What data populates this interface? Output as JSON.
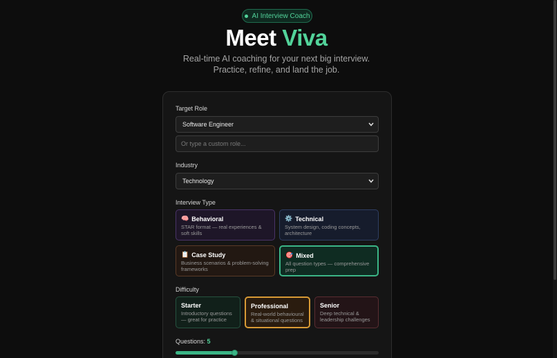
{
  "badge": {
    "label": "AI Interview Coach"
  },
  "hero": {
    "title_prefix": "Meet",
    "title_accent": "Viva",
    "subtitle_line1": "Real-time AI coaching for your next big interview.",
    "subtitle_line2": "Practice, refine, and land the job."
  },
  "form": {
    "target_role": {
      "label": "Target Role",
      "selected": "Software Engineer",
      "custom_placeholder": "Or type a custom role..."
    },
    "industry": {
      "label": "Industry",
      "selected": "Technology"
    },
    "interview_type": {
      "label": "Interview Type",
      "options": [
        {
          "icon": "🧠",
          "icon_name": "brain-icon",
          "title": "Behavioral",
          "desc": "STAR format — real experiences & soft skills"
        },
        {
          "icon": "⚙️",
          "icon_name": "gear-icon",
          "title": "Technical",
          "desc": "System design, coding concepts, architecture"
        },
        {
          "icon": "📋",
          "icon_name": "clipboard-icon",
          "title": "Case Study",
          "desc": "Business scenarios & problem-solving frameworks"
        },
        {
          "icon": "🎯",
          "icon_name": "target-icon",
          "title": "Mixed",
          "desc": "All question types — comprehensive prep"
        }
      ],
      "selected": "Mixed"
    },
    "difficulty": {
      "label": "Difficulty",
      "options": [
        {
          "title": "Starter",
          "desc": "Introductory questions — great for practice"
        },
        {
          "title": "Professional",
          "desc": "Real-world behavioural & situational questions"
        },
        {
          "title": "Senior",
          "desc": "Deep technical & leadership challenges"
        }
      ],
      "selected": "Professional"
    },
    "questions": {
      "label": "Questions:",
      "value": "5",
      "slider_fraction": 0.29
    }
  },
  "colors": {
    "accent": "#52d39a",
    "background": "#0d0d0d",
    "card": "#151515",
    "professional_border": "#d89a35"
  }
}
